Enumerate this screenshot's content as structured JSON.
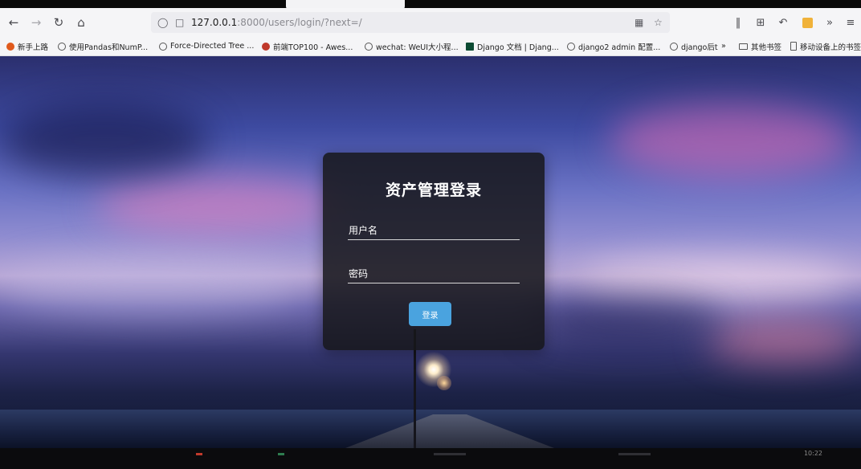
{
  "browser": {
    "url_host": "127.0.0.1",
    "url_rest": ":8000/users/login/?next=/",
    "colors": {
      "chrome": "#f5f5f7",
      "urlbar": "#ececf0"
    }
  },
  "bookmarks": [
    {
      "label": "新手上路",
      "icon": "firefox-icon"
    },
    {
      "label": "使用Pandas和NumP...",
      "icon": "globe-icon"
    },
    {
      "label": "Force-Directed Tree ...",
      "icon": "globe-icon"
    },
    {
      "label": "前端TOP100 - Awes...",
      "icon": "site-icon"
    },
    {
      "label": "wechat: WeUI大小程...",
      "icon": "globe-icon"
    },
    {
      "label": "Django 文档 | Djang...",
      "icon": "django-icon"
    },
    {
      "label": "django2 admin 配置...",
      "icon": "globe-icon"
    },
    {
      "label": "django后t",
      "icon": "globe-icon"
    },
    {
      "label": "其他书签",
      "icon": "folder-icon"
    },
    {
      "label": "移动设备上的书签",
      "icon": "phone-icon"
    }
  ],
  "login": {
    "title": "资产管理登录",
    "username_label": "用户名",
    "password_label": "密码",
    "submit_label": "登录",
    "colors": {
      "card": "#16161a",
      "button": "#4aa3df",
      "text": "#ffffff"
    }
  },
  "taskbar": {
    "clock": "10:22"
  }
}
